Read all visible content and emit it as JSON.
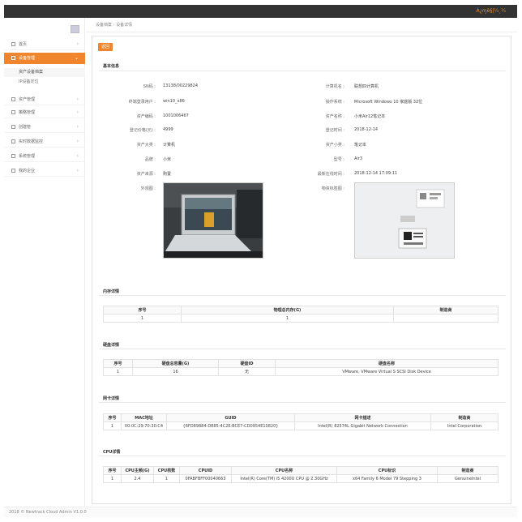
{
  "topbar": {
    "user": "Ȧ¿ɱè§|¼¸¼"
  },
  "sidebar": {
    "items": [
      {
        "label": "首页",
        "active": false
      },
      {
        "label": "设备管理",
        "active": true
      },
      {
        "label": "资产管理",
        "active": false
      },
      {
        "label": "策略管理",
        "active": false
      },
      {
        "label": "创建管",
        "active": false
      },
      {
        "label": "实时数据监控",
        "active": false
      },
      {
        "label": "系统管理",
        "active": false
      },
      {
        "label": "我的企业",
        "active": false
      }
    ],
    "subitems": [
      "资产设备档案",
      "IP设备定位"
    ]
  },
  "breadcrumb": "设备档案  ›  设备详情",
  "back_label": "返回",
  "basic": {
    "title": "基本信息",
    "left": [
      {
        "label": "SN码 :",
        "value": "13138/00229824"
      },
      {
        "label": "终端登录用户 :",
        "value": "win10_x86"
      },
      {
        "label": "资产编码 :",
        "value": "1001006467"
      },
      {
        "label": "登记价格(元) :",
        "value": "4999"
      },
      {
        "label": "资产大类 :",
        "value": "计算机"
      },
      {
        "label": "品牌 :",
        "value": "小米"
      },
      {
        "label": "资产来源 :",
        "value": "购置"
      },
      {
        "label": "外观图 :",
        "value": ""
      }
    ],
    "right": [
      {
        "label": "计算机名 :",
        "value": "联想四计算机"
      },
      {
        "label": "操作系统 :",
        "value": "Microsoft Windows 10 家庭版 32位"
      },
      {
        "label": "资产名称 :",
        "value": "小米Air12笔记本"
      },
      {
        "label": "登记时间 :",
        "value": "2018-12-14"
      },
      {
        "label": "资产小类 :",
        "value": "笔记本"
      },
      {
        "label": "型号 :",
        "value": "Air3"
      },
      {
        "label": "最新在线时间 :",
        "value": "2018-12-14 17:09:11"
      },
      {
        "label": "物资标签图 :",
        "value": ""
      }
    ]
  },
  "memory": {
    "title": "内存详情",
    "headers": [
      "序号",
      "物理总内存(G)",
      "制造商"
    ],
    "rows": [
      [
        "1",
        "1",
        ""
      ]
    ]
  },
  "disk": {
    "title": "硬盘详情",
    "headers": [
      "序号",
      "硬盘总容量(G)",
      "硬盘ID",
      "硬盘名称"
    ],
    "rows": [
      [
        "1",
        "16",
        "无",
        "VMware, VMware Virtual S SCSI Disk Device"
      ]
    ]
  },
  "nic": {
    "title": "网卡详情",
    "headers": [
      "序号",
      "MAC地址",
      "GUID",
      "网卡描述",
      "制造商"
    ],
    "rows": [
      [
        "1",
        "00:0C:29:70:30:C4",
        "{6FD89884-D885-4C2E-BCE7-CD0954E10820}",
        "Intel(R) 82574L Gigabit Network Connection",
        "Intel Corporation"
      ]
    ]
  },
  "cpu": {
    "title": "CPU详情",
    "headers": [
      "序号",
      "CPU主频(G)",
      "CPU核数",
      "CPUID",
      "CPU名称",
      "CPU标识",
      "制造商"
    ],
    "rows": [
      [
        "1",
        "2.4",
        "1",
        "0FABFBFF00040663",
        "Intel(R) Core(TM) i5 4200U CPU @ 2.30GHz",
        "x64 Family 6 Model 79 Stepping 3",
        "GenuineIntel"
      ]
    ]
  },
  "footer": "2018 © Newtrack Cloud Admin V1.0.0",
  "colors": {
    "accent": "#f0852e",
    "topbar": "#333333",
    "topbar_text": "#e8903a"
  }
}
